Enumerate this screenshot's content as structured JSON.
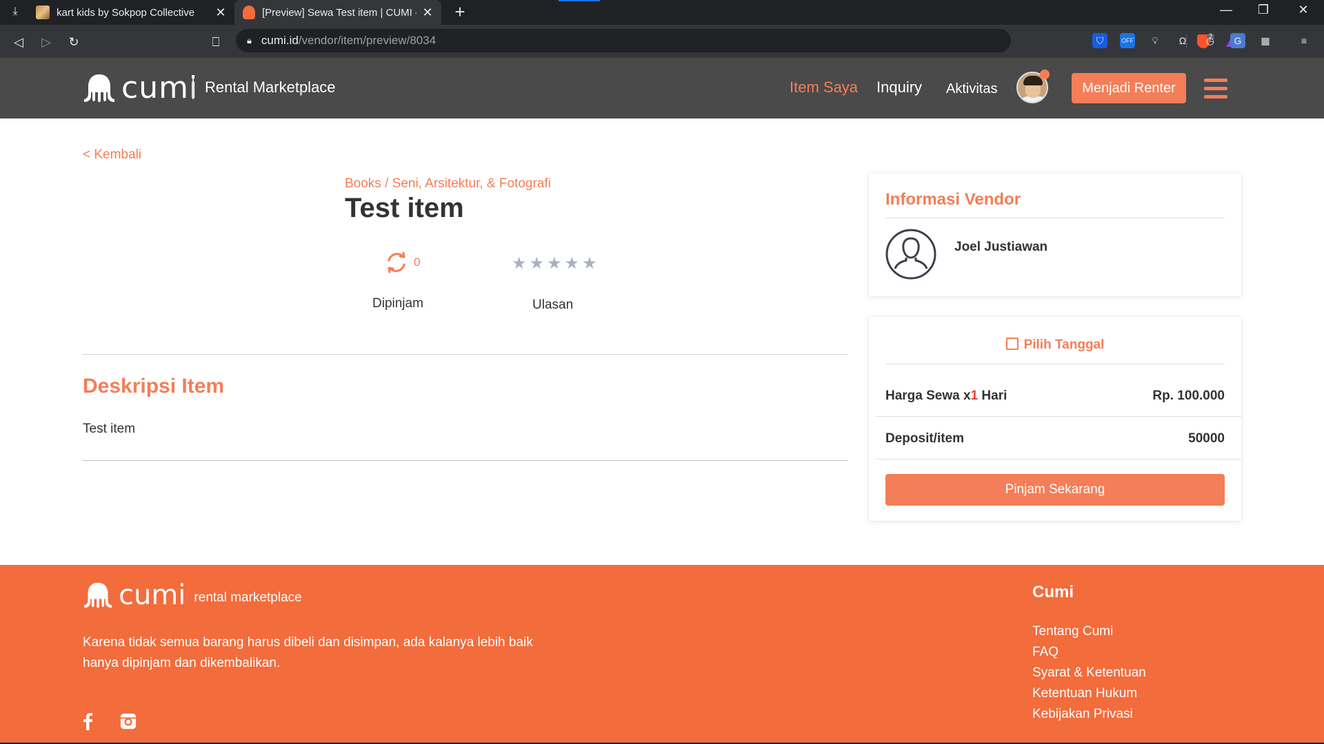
{
  "browser": {
    "tabs": [
      {
        "title": "kart kids by Sokpop Collective"
      },
      {
        "title": "[Preview] Sewa Test item | CUMI - R"
      }
    ],
    "url_host": "cumi.id",
    "url_path": "/vendor/item/preview/8034",
    "brave_badge": "2",
    "extensions": [
      "bitwarden-icon",
      "off-badge-icon",
      "bulb-icon",
      "omega-icon",
      "clock-icon",
      "translate-icon",
      "calculator-icon"
    ]
  },
  "header": {
    "brand": "cumi",
    "subtitle": "Rental Marketplace",
    "nav": {
      "item_saya": "Item Saya",
      "inquiry": "Inquiry",
      "aktivitas": "Aktivitas"
    },
    "cta": "Menjadi Renter"
  },
  "item": {
    "back_link": "< Kembali",
    "breadcrumb": "Books / Seni, Arsitektur, & Fotografi",
    "title": "Test item",
    "borrow_count": "0",
    "borrow_label": "Dipinjam",
    "rating": 0,
    "rating_max": 5,
    "review_label": "Ulasan",
    "description_title": "Deskripsi Item",
    "description": "Test item"
  },
  "vendor": {
    "section_title": "Informasi Vendor",
    "name": "Joel Justiawan"
  },
  "pricing": {
    "pick_date": "Pilih Tanggal",
    "rent_label_prefix": "Harga Sewa x",
    "rent_days": "1",
    "rent_label_suffix": " Hari",
    "rent_value": "Rp. 100.000",
    "deposit_label": "Deposit/item",
    "deposit_value": "50000",
    "cta": "Pinjam Sekarang"
  },
  "footer": {
    "brand": "cumi",
    "tagline": "rental marketplace",
    "text": "Karena tidak semua barang harus dibeli dan disimpan, ada kalanya lebih baik hanya dipinjam dan dikembalikan.",
    "column_title": "Cumi",
    "links": [
      "Tentang Cumi",
      "FAQ",
      "Syarat & Ketentuan",
      "Ketentuan Hukum",
      "Kebijakan Privasi"
    ]
  },
  "colors": {
    "accent": "#f47e57",
    "footer_bg": "#f26c3c",
    "header_bg": "#4a4a4a",
    "star_empty": "#a9b1bd"
  }
}
